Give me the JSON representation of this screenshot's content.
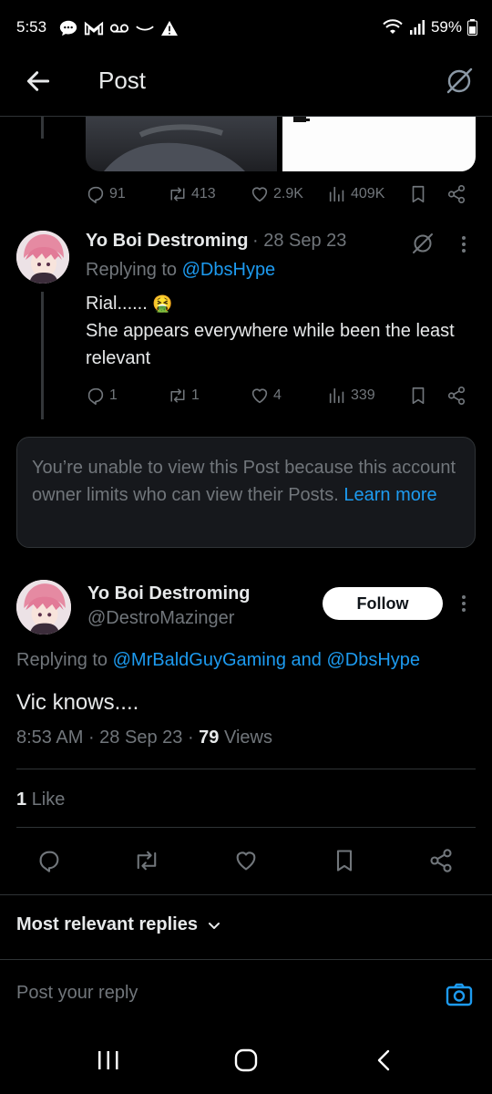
{
  "status": {
    "time": "5:53",
    "battery": "59%"
  },
  "header": {
    "title": "Post"
  },
  "parent_post_actions": {
    "replies": "91",
    "reposts": "413",
    "likes": "2.9K",
    "views": "409K"
  },
  "reply": {
    "name": "Yo Boi Destroming",
    "date": "· 28 Sep 23",
    "replying_prefix": "Replying to ",
    "replying_to": "@DbsHype",
    "line1": "Rial......",
    "emoji": "🤮",
    "line2": "She appears everywhere while been the least relevant",
    "replies": "1",
    "reposts": "1",
    "likes": "4",
    "views": "339"
  },
  "limited": {
    "text": "You’re unable to view this Post because this account owner limits who can view their Posts.",
    "link": "Learn more"
  },
  "main_post": {
    "name": "Yo Boi Destroming",
    "handle": "@DestroMazinger",
    "follow_label": "Follow",
    "replying_prefix": "Replying to ",
    "replying_to_1": "@MrBaldGuyGaming",
    "replying_and": " and ",
    "replying_to_2": "@DbsHype",
    "text": "Vic knows....",
    "time": "8:53 AM",
    "date": "28 Sep 23",
    "views_count": "79",
    "views_label": "Views",
    "likes_count": "1",
    "likes_label": "Like"
  },
  "replies_sort": {
    "label": "Most relevant replies"
  },
  "composer": {
    "placeholder": "Post your reply"
  },
  "colors": {
    "accent": "#1d9bf0",
    "muted": "#71767b",
    "text": "#e7e9ea",
    "background": "#000000"
  }
}
